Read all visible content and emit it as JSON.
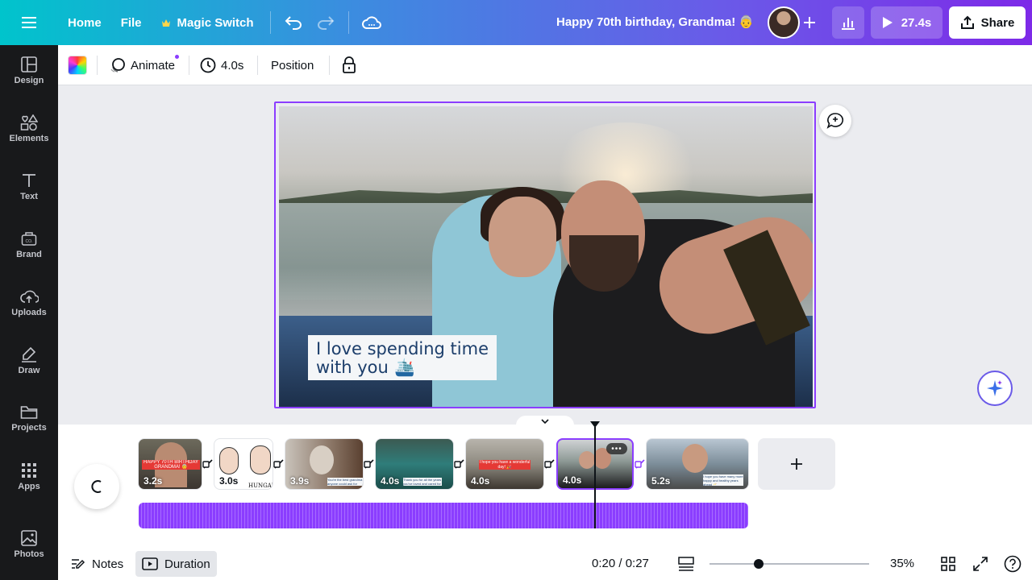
{
  "topbar": {
    "home": "Home",
    "file": "File",
    "magic_switch": "Magic Switch",
    "title": "Happy 70th birthday, Grandma! 👵",
    "play_duration": "27.4s",
    "share": "Share"
  },
  "sidebar": {
    "items": [
      {
        "label": "Design",
        "icon": "layout-icon"
      },
      {
        "label": "Elements",
        "icon": "shapes-icon"
      },
      {
        "label": "Text",
        "icon": "text-icon"
      },
      {
        "label": "Brand",
        "icon": "brand-icon"
      },
      {
        "label": "Uploads",
        "icon": "cloud-upload-icon"
      },
      {
        "label": "Draw",
        "icon": "pen-icon"
      },
      {
        "label": "Projects",
        "icon": "folder-icon"
      },
      {
        "label": "Apps",
        "icon": "grid-icon"
      },
      {
        "label": "Photos",
        "icon": "image-icon"
      }
    ]
  },
  "toolbar": {
    "animate": "Animate",
    "duration": "4.0s",
    "position": "Position"
  },
  "canvas": {
    "caption_line1": "I love spending time",
    "caption_line2": "with you 🛳️"
  },
  "timeline": {
    "clips": [
      {
        "duration": "3.2s",
        "text": "HAPPY 70TH BIRTHDAY GRANDMA! 👵"
      },
      {
        "duration": "3.0s",
        "text": "HUNGAR"
      },
      {
        "duration": "3.9s",
        "text": "You're the best grandma anyone could ask for"
      },
      {
        "duration": "4.0s",
        "text": "Thank you for all the years you've loved and cared for me ❤️"
      },
      {
        "duration": "4.0s",
        "text": "I hope you have a wonderful day! 🎉"
      },
      {
        "duration": "4.0s",
        "text": "",
        "selected": true
      },
      {
        "duration": "5.2s",
        "text": "I hope you have many more happy and healthy years ahead 🥂"
      }
    ]
  },
  "bottombar": {
    "notes": "Notes",
    "duration": "Duration",
    "time": "0:20 / 0:27",
    "zoom": "35%"
  },
  "colors": {
    "accent": "#8b3dff",
    "sidebar_bg": "#18191b",
    "caption_text": "#1c3e6b"
  }
}
